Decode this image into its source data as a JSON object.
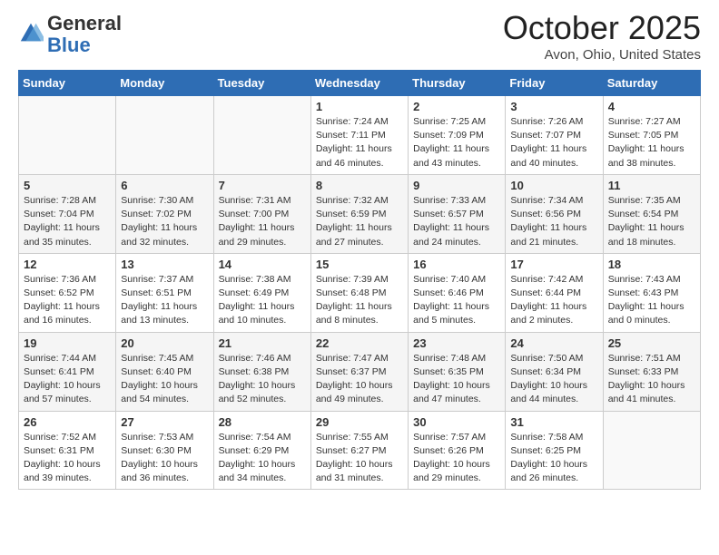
{
  "header": {
    "logo_general": "General",
    "logo_blue": "Blue",
    "month_title": "October 2025",
    "location": "Avon, Ohio, United States"
  },
  "days_of_week": [
    "Sunday",
    "Monday",
    "Tuesday",
    "Wednesday",
    "Thursday",
    "Friday",
    "Saturday"
  ],
  "weeks": [
    [
      {
        "day": "",
        "sunrise": "",
        "sunset": "",
        "daylight": ""
      },
      {
        "day": "",
        "sunrise": "",
        "sunset": "",
        "daylight": ""
      },
      {
        "day": "",
        "sunrise": "",
        "sunset": "",
        "daylight": ""
      },
      {
        "day": "1",
        "sunrise": "Sunrise: 7:24 AM",
        "sunset": "Sunset: 7:11 PM",
        "daylight": "Daylight: 11 hours and 46 minutes."
      },
      {
        "day": "2",
        "sunrise": "Sunrise: 7:25 AM",
        "sunset": "Sunset: 7:09 PM",
        "daylight": "Daylight: 11 hours and 43 minutes."
      },
      {
        "day": "3",
        "sunrise": "Sunrise: 7:26 AM",
        "sunset": "Sunset: 7:07 PM",
        "daylight": "Daylight: 11 hours and 40 minutes."
      },
      {
        "day": "4",
        "sunrise": "Sunrise: 7:27 AM",
        "sunset": "Sunset: 7:05 PM",
        "daylight": "Daylight: 11 hours and 38 minutes."
      }
    ],
    [
      {
        "day": "5",
        "sunrise": "Sunrise: 7:28 AM",
        "sunset": "Sunset: 7:04 PM",
        "daylight": "Daylight: 11 hours and 35 minutes."
      },
      {
        "day": "6",
        "sunrise": "Sunrise: 7:30 AM",
        "sunset": "Sunset: 7:02 PM",
        "daylight": "Daylight: 11 hours and 32 minutes."
      },
      {
        "day": "7",
        "sunrise": "Sunrise: 7:31 AM",
        "sunset": "Sunset: 7:00 PM",
        "daylight": "Daylight: 11 hours and 29 minutes."
      },
      {
        "day": "8",
        "sunrise": "Sunrise: 7:32 AM",
        "sunset": "Sunset: 6:59 PM",
        "daylight": "Daylight: 11 hours and 27 minutes."
      },
      {
        "day": "9",
        "sunrise": "Sunrise: 7:33 AM",
        "sunset": "Sunset: 6:57 PM",
        "daylight": "Daylight: 11 hours and 24 minutes."
      },
      {
        "day": "10",
        "sunrise": "Sunrise: 7:34 AM",
        "sunset": "Sunset: 6:56 PM",
        "daylight": "Daylight: 11 hours and 21 minutes."
      },
      {
        "day": "11",
        "sunrise": "Sunrise: 7:35 AM",
        "sunset": "Sunset: 6:54 PM",
        "daylight": "Daylight: 11 hours and 18 minutes."
      }
    ],
    [
      {
        "day": "12",
        "sunrise": "Sunrise: 7:36 AM",
        "sunset": "Sunset: 6:52 PM",
        "daylight": "Daylight: 11 hours and 16 minutes."
      },
      {
        "day": "13",
        "sunrise": "Sunrise: 7:37 AM",
        "sunset": "Sunset: 6:51 PM",
        "daylight": "Daylight: 11 hours and 13 minutes."
      },
      {
        "day": "14",
        "sunrise": "Sunrise: 7:38 AM",
        "sunset": "Sunset: 6:49 PM",
        "daylight": "Daylight: 11 hours and 10 minutes."
      },
      {
        "day": "15",
        "sunrise": "Sunrise: 7:39 AM",
        "sunset": "Sunset: 6:48 PM",
        "daylight": "Daylight: 11 hours and 8 minutes."
      },
      {
        "day": "16",
        "sunrise": "Sunrise: 7:40 AM",
        "sunset": "Sunset: 6:46 PM",
        "daylight": "Daylight: 11 hours and 5 minutes."
      },
      {
        "day": "17",
        "sunrise": "Sunrise: 7:42 AM",
        "sunset": "Sunset: 6:44 PM",
        "daylight": "Daylight: 11 hours and 2 minutes."
      },
      {
        "day": "18",
        "sunrise": "Sunrise: 7:43 AM",
        "sunset": "Sunset: 6:43 PM",
        "daylight": "Daylight: 11 hours and 0 minutes."
      }
    ],
    [
      {
        "day": "19",
        "sunrise": "Sunrise: 7:44 AM",
        "sunset": "Sunset: 6:41 PM",
        "daylight": "Daylight: 10 hours and 57 minutes."
      },
      {
        "day": "20",
        "sunrise": "Sunrise: 7:45 AM",
        "sunset": "Sunset: 6:40 PM",
        "daylight": "Daylight: 10 hours and 54 minutes."
      },
      {
        "day": "21",
        "sunrise": "Sunrise: 7:46 AM",
        "sunset": "Sunset: 6:38 PM",
        "daylight": "Daylight: 10 hours and 52 minutes."
      },
      {
        "day": "22",
        "sunrise": "Sunrise: 7:47 AM",
        "sunset": "Sunset: 6:37 PM",
        "daylight": "Daylight: 10 hours and 49 minutes."
      },
      {
        "day": "23",
        "sunrise": "Sunrise: 7:48 AM",
        "sunset": "Sunset: 6:35 PM",
        "daylight": "Daylight: 10 hours and 47 minutes."
      },
      {
        "day": "24",
        "sunrise": "Sunrise: 7:50 AM",
        "sunset": "Sunset: 6:34 PM",
        "daylight": "Daylight: 10 hours and 44 minutes."
      },
      {
        "day": "25",
        "sunrise": "Sunrise: 7:51 AM",
        "sunset": "Sunset: 6:33 PM",
        "daylight": "Daylight: 10 hours and 41 minutes."
      }
    ],
    [
      {
        "day": "26",
        "sunrise": "Sunrise: 7:52 AM",
        "sunset": "Sunset: 6:31 PM",
        "daylight": "Daylight: 10 hours and 39 minutes."
      },
      {
        "day": "27",
        "sunrise": "Sunrise: 7:53 AM",
        "sunset": "Sunset: 6:30 PM",
        "daylight": "Daylight: 10 hours and 36 minutes."
      },
      {
        "day": "28",
        "sunrise": "Sunrise: 7:54 AM",
        "sunset": "Sunset: 6:29 PM",
        "daylight": "Daylight: 10 hours and 34 minutes."
      },
      {
        "day": "29",
        "sunrise": "Sunrise: 7:55 AM",
        "sunset": "Sunset: 6:27 PM",
        "daylight": "Daylight: 10 hours and 31 minutes."
      },
      {
        "day": "30",
        "sunrise": "Sunrise: 7:57 AM",
        "sunset": "Sunset: 6:26 PM",
        "daylight": "Daylight: 10 hours and 29 minutes."
      },
      {
        "day": "31",
        "sunrise": "Sunrise: 7:58 AM",
        "sunset": "Sunset: 6:25 PM",
        "daylight": "Daylight: 10 hours and 26 minutes."
      },
      {
        "day": "",
        "sunrise": "",
        "sunset": "",
        "daylight": ""
      }
    ]
  ]
}
